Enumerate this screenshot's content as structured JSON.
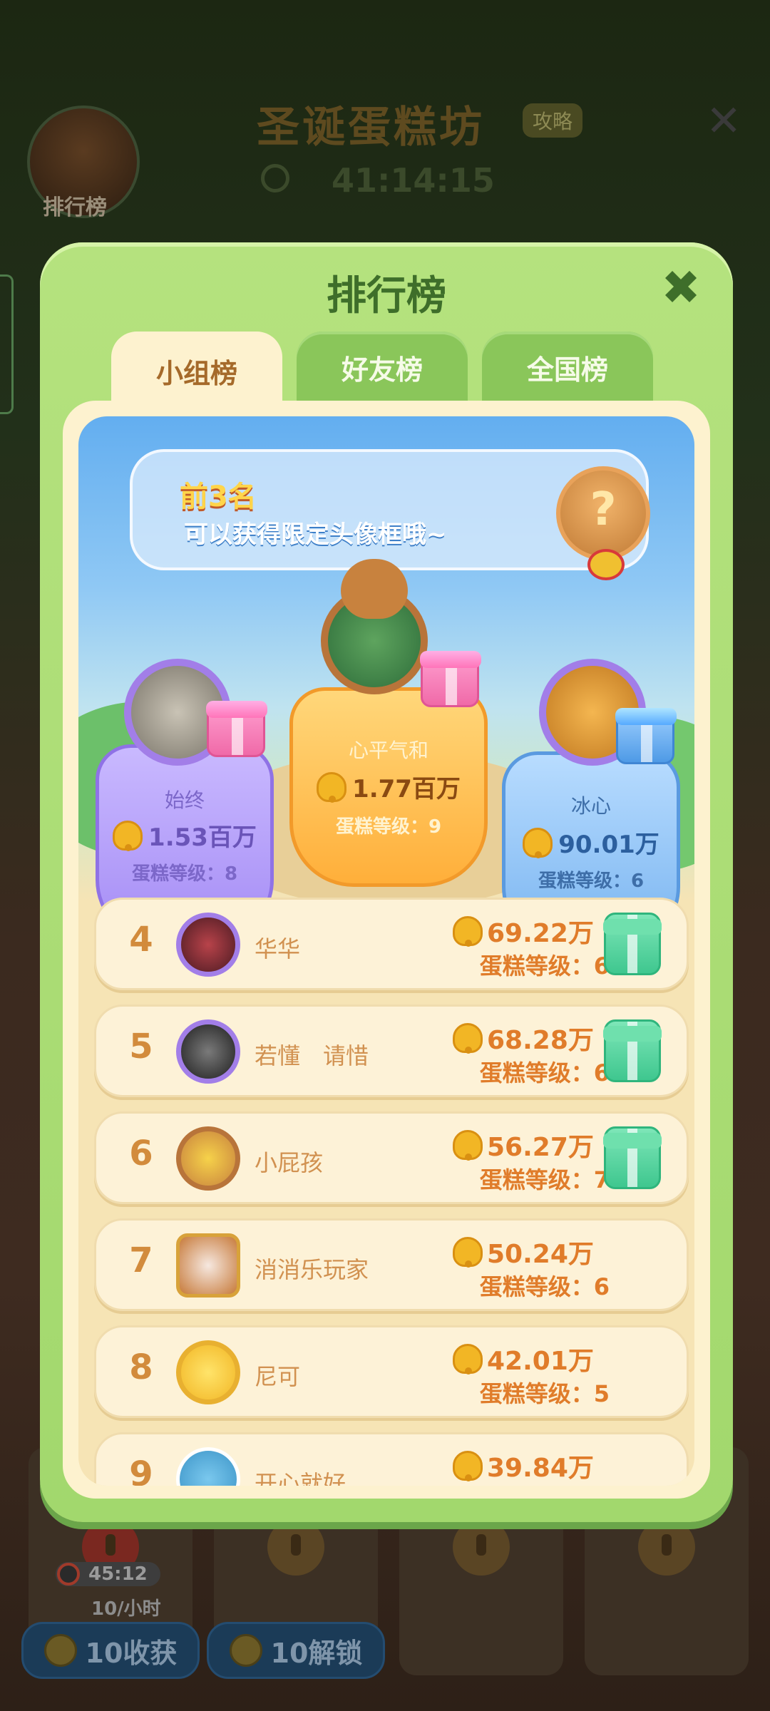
{
  "background": {
    "title": "圣诞蛋糕坊",
    "badge": "攻略",
    "timer": "41:14:15",
    "avatar_label": "排行榜",
    "bottom_timer": "45:12",
    "bottom_rate": "10/小时",
    "harvest_button": "10收获",
    "unlock_button": "10解锁"
  },
  "modal": {
    "title": "排行榜",
    "tabs": [
      {
        "label": "小组榜",
        "active": true
      },
      {
        "label": "好友榜",
        "active": false
      },
      {
        "label": "全国榜",
        "active": false
      }
    ],
    "banner": {
      "top_text": "前3名",
      "sub_text": "可以获得限定头像框哦~"
    },
    "podium": {
      "first": {
        "name": "心平气和",
        "score": "1.77百万",
        "level": "蛋糕等级：9"
      },
      "second": {
        "name": "始终",
        "score": "1.53百万",
        "level": "蛋糕等级：8"
      },
      "third": {
        "name": "冰心",
        "score": "90.01万",
        "level": "蛋糕等级：6"
      }
    },
    "rows": [
      {
        "rank": "4",
        "name": "华华",
        "score": "69.22万",
        "level": "蛋糕等级：6",
        "gift": true
      },
      {
        "rank": "5",
        "name": "若懂　请惜",
        "score": "68.28万",
        "level": "蛋糕等级：6",
        "gift": true
      },
      {
        "rank": "6",
        "name": "小屁孩",
        "score": "56.27万",
        "level": "蛋糕等级：7",
        "gift": true
      },
      {
        "rank": "7",
        "name": "消消乐玩家",
        "score": "50.24万",
        "level": "蛋糕等级：6",
        "gift": false
      },
      {
        "rank": "8",
        "name": "尼可",
        "score": "42.01万",
        "level": "蛋糕等级：5",
        "gift": false
      },
      {
        "rank": "9",
        "name": "开心就好",
        "score": "39.84万",
        "level": "",
        "gift": false
      }
    ]
  },
  "colors": {
    "modal_green": "#a2d86d",
    "tab_active": "#fdf2cf",
    "gold": "#e07c2a",
    "first_place": "#ffaf3a",
    "second_place": "#a58cf5",
    "third_place": "#79b4f0"
  }
}
